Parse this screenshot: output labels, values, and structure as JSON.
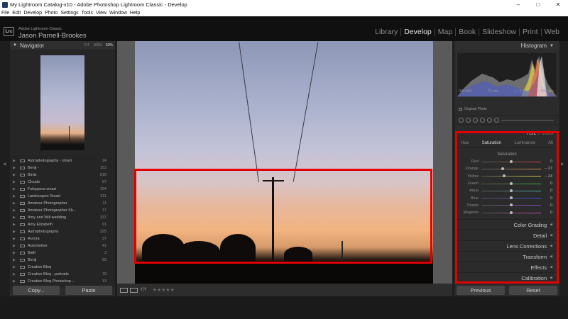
{
  "window": {
    "title": "My Lightroom Catalog-v10 - Adobe Photoshop Lightroom Classic - Develop",
    "controls": [
      "–",
      "□",
      "✕"
    ]
  },
  "menu": [
    "File",
    "Edit",
    "Develop",
    "Photo",
    "Settings",
    "Tools",
    "View",
    "Window",
    "Help"
  ],
  "identity": {
    "logo": "Lrc",
    "app": "Adobe Lightroom Classic",
    "user": "Jason Parnell-Brookes"
  },
  "modules": [
    "Library",
    "Develop",
    "Map",
    "Book",
    "Slideshow",
    "Print",
    "Web"
  ],
  "active_module": "Develop",
  "navigator": {
    "title": "Navigator",
    "zoom": [
      "FIT",
      "100%",
      "50%"
    ],
    "selected_zoom": "50%"
  },
  "collections": [
    {
      "name": "Astrophotography - smart",
      "count": "24"
    },
    {
      "name": "Benji -",
      "count": "153"
    },
    {
      "name": "Birds",
      "count": "616"
    },
    {
      "name": "Clouds",
      "count": "67"
    },
    {
      "name": "Fstoppers-smart",
      "count": "194"
    },
    {
      "name": "Landscapes Smart",
      "count": "211"
    },
    {
      "name": "Amateur Photographer",
      "count": "11"
    },
    {
      "name": "Amateur Photographer Sh...",
      "count": "17"
    },
    {
      "name": "Amy and Will wedding",
      "count": "337"
    },
    {
      "name": "Amy Elizabeth",
      "count": "91"
    },
    {
      "name": "Astrophotography",
      "count": "325"
    },
    {
      "name": "Aurora",
      "count": "37"
    },
    {
      "name": "Automotive",
      "count": "41"
    },
    {
      "name": "Bath",
      "count": "3"
    },
    {
      "name": "Benji",
      "count": "93"
    },
    {
      "name": "Creative Bloq",
      "count": ""
    },
    {
      "name": "Creative Bloq - portraits",
      "count": "79"
    },
    {
      "name": "Creative Bloq Photoshop ...",
      "count": "13"
    }
  ],
  "left_buttons": {
    "copy": "Copy...",
    "paste": "Paste"
  },
  "toolbar": {
    "stars": "★★★★★",
    "compare_label": "Y|Y"
  },
  "histogram": {
    "title": "Histogram",
    "iso": "ISO 800",
    "focal": "70 mm",
    "aperture": "ƒ / 2.8",
    "shutter": "1/60 sec",
    "original_photo": "Original Photo"
  },
  "hsl": {
    "title": "HSL",
    "sep": "/",
    "color": "Color",
    "tabs": [
      "Hue",
      "Saturation",
      "Luminance",
      "All"
    ],
    "selected_tab": "Saturation",
    "group_label": "Saturation",
    "sliders": [
      {
        "name": "Red",
        "value": "0",
        "pos": 0.5,
        "color": "#c44"
      },
      {
        "name": "Orange",
        "value": "– 27",
        "pos": 0.36,
        "color": "#d84"
      },
      {
        "name": "Yellow",
        "value": "– 24",
        "pos": 0.38,
        "color": "#cc4"
      },
      {
        "name": "Green",
        "value": "0",
        "pos": 0.5,
        "color": "#4a4"
      },
      {
        "name": "Aqua",
        "value": "0",
        "pos": 0.5,
        "color": "#4aa"
      },
      {
        "name": "Blue",
        "value": "0",
        "pos": 0.5,
        "color": "#44c"
      },
      {
        "name": "Purple",
        "value": "0",
        "pos": 0.5,
        "color": "#84c"
      },
      {
        "name": "Magenta",
        "value": "0",
        "pos": 0.5,
        "color": "#c4a"
      }
    ]
  },
  "panels": [
    "Color Grading",
    "Detail",
    "Lens Corrections",
    "Transform",
    "Effects",
    "Calibration"
  ],
  "right_buttons": {
    "previous": "Previous",
    "reset": "Reset"
  }
}
